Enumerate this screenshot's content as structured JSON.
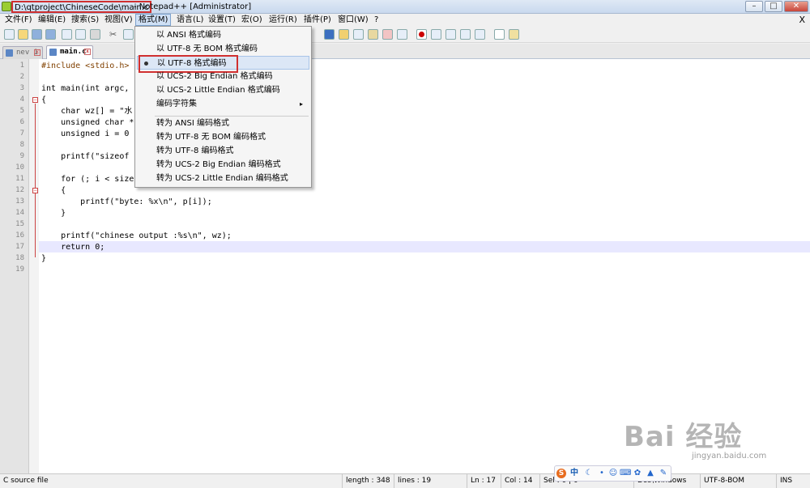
{
  "window": {
    "title_path": "D:\\qtproject\\ChineseCode\\main.c",
    "title_rest": " - Notepad++ [Administrator]",
    "buttons": {
      "minimize": "–",
      "maximize": "□",
      "close": "✕"
    }
  },
  "menubar": {
    "items": [
      "文件(F)",
      "编辑(E)",
      "搜索(S)",
      "视图(V)",
      "格式(M)",
      "语言(L)",
      "设置(T)",
      "宏(O)",
      "运行(R)",
      "插件(P)",
      "窗口(W)",
      "?"
    ],
    "close": "X"
  },
  "tabs": [
    {
      "label": "nev 1"
    },
    {
      "label": "main.c"
    }
  ],
  "editor": {
    "line_numbers": [
      "1",
      "2",
      "3",
      "4",
      "5",
      "6",
      "7",
      "8",
      "9",
      "10",
      "11",
      "12",
      "13",
      "14",
      "15",
      "16",
      "17",
      "18",
      "19"
    ],
    "lines": [
      "#include <stdio.h>",
      "",
      "int main(int argc,",
      "{",
      "    char wz[] = \"水",
      "    unsigned char *",
      "    unsigned i = 0",
      "",
      "    printf(\"sizeof",
      "",
      "    for (; i < size",
      "    {",
      "        printf(\"byte: %x\\n\", p[i]);",
      "    }",
      "",
      "    printf(\"chinese output :%s\\n\", wz);",
      "    return 0;",
      "}",
      ""
    ],
    "current_line": 17
  },
  "format_menu": {
    "items": [
      {
        "label": "以 ANSI 格式编码",
        "checked": false
      },
      {
        "label": "以 UTF-8 无 BOM 格式编码",
        "checked": false
      },
      {
        "label": "以 UTF-8 格式编码",
        "checked": true
      },
      {
        "label": "以 UCS-2 Big Endian 格式编码",
        "checked": false
      },
      {
        "label": "以 UCS-2 Little Endian 格式编码",
        "checked": false
      },
      {
        "label": "编码字符集",
        "checked": false,
        "submenu": true
      },
      {
        "label": "转为 ANSI 编码格式",
        "checked": false
      },
      {
        "label": "转为 UTF-8 无 BOM 编码格式",
        "checked": false
      },
      {
        "label": "转为 UTF-8 编码格式",
        "checked": false
      },
      {
        "label": "转为 UCS-2 Big Endian 编码格式",
        "checked": false
      },
      {
        "label": "转为 UCS-2 Little Endian 编码格式",
        "checked": false
      }
    ],
    "submenu_arrow": "▸"
  },
  "statusbar": {
    "file_type": "C source file",
    "length": "length : 348",
    "lines": "lines : 19",
    "ln": "Ln : 17",
    "col": "Col : 14",
    "sel": "Sel : 0 | 0",
    "eol": "Dos\\Windows",
    "encoding": "UTF-8-BOM",
    "mode": "INS"
  },
  "ime": {
    "logo": "S",
    "lang": "中"
  },
  "watermark": {
    "logo": "Bai 经验",
    "url": "jingyan.baidu.com"
  },
  "colors": {
    "highlight_box": "#d03030",
    "current_line": "#e8e8ff"
  }
}
